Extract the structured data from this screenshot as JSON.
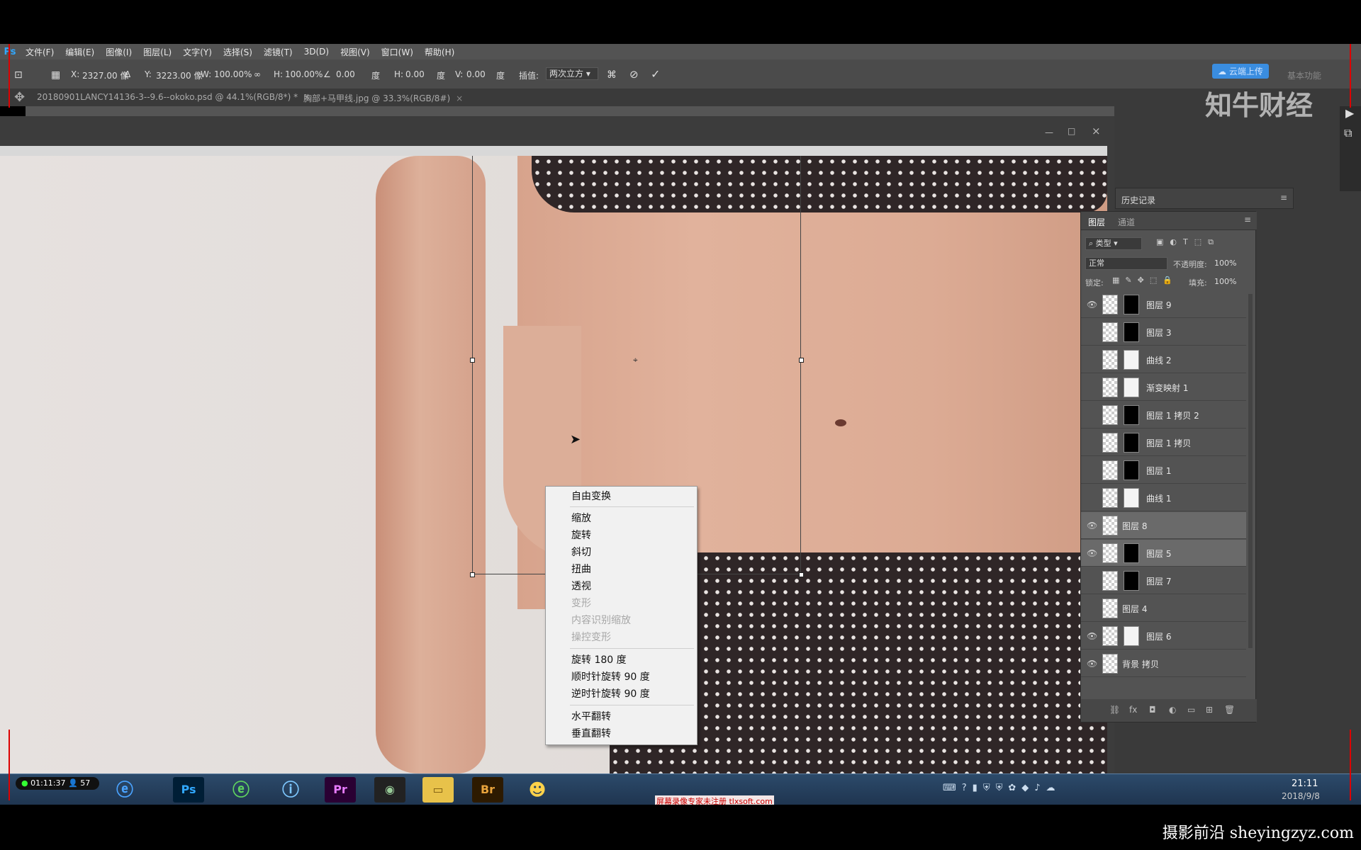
{
  "app": {
    "logo": "Ps",
    "menu": [
      "文件(F)",
      "编辑(E)",
      "图像(I)",
      "图层(L)",
      "文字(Y)",
      "选择(S)",
      "滤镜(T)",
      "3D(D)",
      "视图(V)",
      "窗口(W)",
      "帮助(H)"
    ]
  },
  "options": {
    "x_label": "X:",
    "x_value": "2327.00 像",
    "y_label": "Y:",
    "y_value": "3223.00 像",
    "w_label": "W:",
    "w_value": "100.00%",
    "h_label": "H:",
    "h_value": "100.00%",
    "angle_value": "0.00",
    "angle_unit": "度",
    "hskew_label": "H:",
    "hskew_value": "0.00",
    "hskew_unit": "度",
    "vskew_label": "V:",
    "vskew_value": "0.00",
    "vskew_unit": "度",
    "interp_label": "插值:",
    "interp_value": "两次立方",
    "cancel_icon": "cancel-icon",
    "commit_icon": "check-icon",
    "cloud_button": "云端上传",
    "workspace": "基本功能"
  },
  "tabs": [
    {
      "label": "20180901LANCY14136-3--9.6--okoko.psd @ 44.1%(RGB/8*) *"
    },
    {
      "label": "胸部+马甲线.jpg @ 33.3%(RGB/8#)"
    }
  ],
  "watermark_brand": "知牛财经",
  "context_menu": {
    "items": [
      {
        "label": "自由变换",
        "enabled": true
      },
      {
        "label": "缩放",
        "enabled": true
      },
      {
        "label": "旋转",
        "enabled": true
      },
      {
        "label": "斜切",
        "enabled": true
      },
      {
        "label": "扭曲",
        "enabled": true
      },
      {
        "label": "透视",
        "enabled": true
      },
      {
        "label": "变形",
        "enabled": false
      },
      {
        "label": "内容识别缩放",
        "enabled": false
      },
      {
        "label": "操控变形",
        "enabled": false
      },
      {
        "label": "旋转 180 度",
        "enabled": true
      },
      {
        "label": "顺时针旋转 90 度",
        "enabled": true
      },
      {
        "label": "逆时针旋转 90 度",
        "enabled": true
      },
      {
        "label": "水平翻转",
        "enabled": true
      },
      {
        "label": "垂直翻转",
        "enabled": true
      }
    ]
  },
  "history_panel": {
    "title": "历史记录"
  },
  "layers_panel": {
    "tabs": [
      "图层",
      "通道"
    ],
    "filter_kind": "类型",
    "blend_mode": "正常",
    "opacity_label": "不透明度:",
    "opacity_value": "100%",
    "lock_label": "锁定:",
    "fill_label": "填充:",
    "fill_value": "100%",
    "layers": [
      {
        "name": "图层 9",
        "visible": true,
        "selected": false,
        "mask": "dark"
      },
      {
        "name": "图层 3",
        "visible": false,
        "selected": false,
        "mask": "dark"
      },
      {
        "name": "曲线 2",
        "visible": false,
        "selected": false,
        "mask": "white"
      },
      {
        "name": "渐变映射 1",
        "visible": false,
        "selected": false,
        "mask": "white"
      },
      {
        "name": "图层 1 拷贝 2",
        "visible": false,
        "selected": false,
        "mask": "dark"
      },
      {
        "name": "图层 1 拷贝",
        "visible": false,
        "selected": false,
        "mask": "dark"
      },
      {
        "name": "图层 1",
        "visible": false,
        "selected": false,
        "mask": "dark"
      },
      {
        "name": "曲线 1",
        "visible": false,
        "selected": false,
        "mask": "white"
      },
      {
        "name": "图层 8",
        "visible": true,
        "selected": true,
        "mask": "none"
      },
      {
        "name": "图层 5",
        "visible": true,
        "selected": true,
        "mask": "dark"
      },
      {
        "name": "图层 7",
        "visible": false,
        "selected": false,
        "mask": "dark"
      },
      {
        "name": "图层 4",
        "visible": false,
        "selected": false,
        "mask": "none"
      },
      {
        "name": "图层 6",
        "visible": true,
        "selected": false,
        "mask": "white"
      },
      {
        "name": "背景 拷贝",
        "visible": true,
        "selected": false,
        "mask": "none"
      }
    ]
  },
  "taskbar": {
    "recorder_time": "01:11:37",
    "recorder_count": "57",
    "apps": [
      "ie-icon",
      "Ps",
      "360-browser-icon",
      "info-icon",
      "Pr",
      "camera-icon",
      "folder-icon",
      "Br",
      "qq-pet-icon"
    ],
    "clock_time": "21:11",
    "clock_date": "2018/9/8",
    "recorder_notice": "屏幕录像专家未注册 tlxsoft.com"
  },
  "site_watermark": "摄影前沿 sheyingzyz.com"
}
